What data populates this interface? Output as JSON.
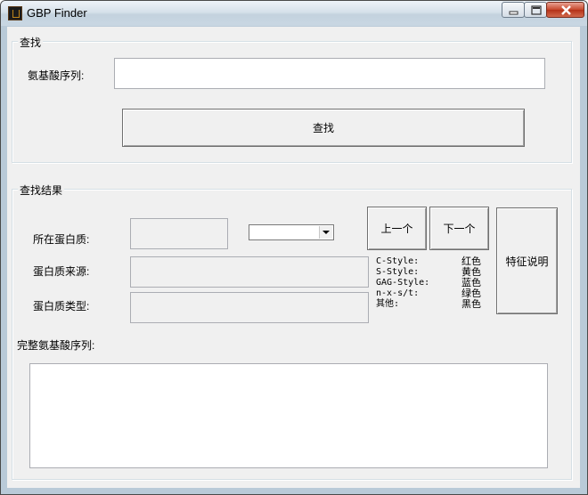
{
  "window": {
    "title": "GBP Finder"
  },
  "search_group": {
    "legend": "查找",
    "sequence_label": "氨基酸序列:",
    "sequence_value": "",
    "search_button": "查找"
  },
  "results_group": {
    "legend": "查找结果",
    "protein_label": "所在蛋白质:",
    "protein_value": "",
    "selector_value": "",
    "prev_button": "上一个",
    "next_button": "下一个",
    "feature_button": "特征说明",
    "source_label": "蛋白质来源:",
    "source_value": "",
    "type_label": "蛋白质类型:",
    "type_value": "",
    "legend_rows": [
      {
        "style": "C-Style:",
        "color": "红色"
      },
      {
        "style": "S-Style:",
        "color": "黄色"
      },
      {
        "style": "GAG-Style:",
        "color": "蓝色"
      },
      {
        "style": "n-x-s/t:",
        "color": "绿色"
      },
      {
        "style": "其他:",
        "color": "黑色"
      }
    ],
    "full_sequence_label": "完整氨基酸序列:",
    "full_sequence_value": ""
  }
}
